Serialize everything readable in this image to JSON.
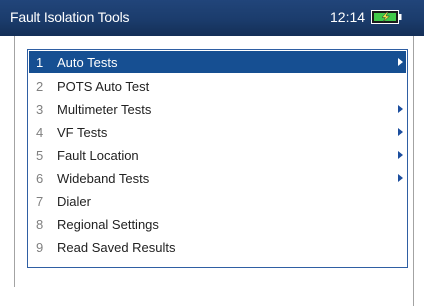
{
  "header": {
    "title": "Fault Isolation Tools",
    "time": "12:14",
    "battery_icon": "battery-charging-icon",
    "background": "#1b3c6c",
    "text_color": "#ffffff"
  },
  "menu": {
    "accent": "#164f92",
    "items": [
      {
        "number": "1",
        "label": "Auto Tests",
        "submenu": true,
        "selected": true
      },
      {
        "number": "2",
        "label": "POTS Auto Test",
        "submenu": false,
        "selected": false
      },
      {
        "number": "3",
        "label": "Multimeter Tests",
        "submenu": true,
        "selected": false
      },
      {
        "number": "4",
        "label": "VF Tests",
        "submenu": true,
        "selected": false
      },
      {
        "number": "5",
        "label": "Fault Location",
        "submenu": true,
        "selected": false
      },
      {
        "number": "6",
        "label": "Wideband Tests",
        "submenu": true,
        "selected": false
      },
      {
        "number": "7",
        "label": "Dialer",
        "submenu": false,
        "selected": false
      },
      {
        "number": "8",
        "label": "Regional Settings",
        "submenu": false,
        "selected": false
      },
      {
        "number": "9",
        "label": "Read Saved Results",
        "submenu": false,
        "selected": false
      }
    ]
  }
}
